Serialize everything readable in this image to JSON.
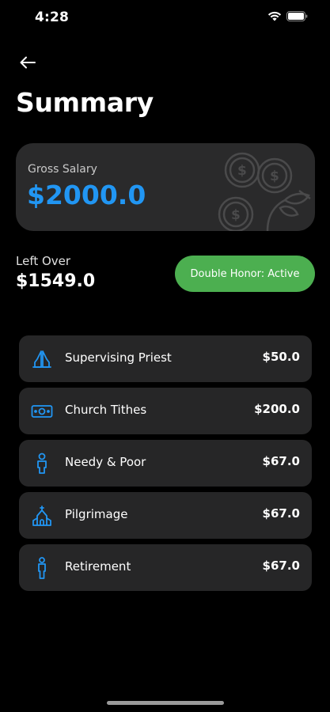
{
  "status_bar": {
    "time": "4:28"
  },
  "header": {
    "back_icon": "arrow-left-icon",
    "title": "Summary"
  },
  "salary_card": {
    "label": "Gross Salary",
    "amount": "$2000.0",
    "amount_color": "#2196f3",
    "background_art": "money-coins-icon"
  },
  "left_over": {
    "label": "Left Over",
    "amount": "$1549.0"
  },
  "honor_button": {
    "label": "Double Honor: Active",
    "color": "#4caf50"
  },
  "expenses": [
    {
      "name": "Supervising Priest",
      "value": "$50.0",
      "icon": "praying-hands-icon"
    },
    {
      "name": "Church Tithes",
      "value": "$200.0",
      "icon": "money-bill-icon"
    },
    {
      "name": "Needy & Poor",
      "value": "$67.0",
      "icon": "person-icon"
    },
    {
      "name": "Pilgrimage",
      "value": "$67.0",
      "icon": "church-icon"
    },
    {
      "name": "Retirement",
      "value": "$67.0",
      "icon": "standing-person-icon"
    }
  ],
  "colors": {
    "background": "#000000",
    "card": "#2a2a2b",
    "row": "#262627",
    "icon_accent": "#2196f3"
  }
}
